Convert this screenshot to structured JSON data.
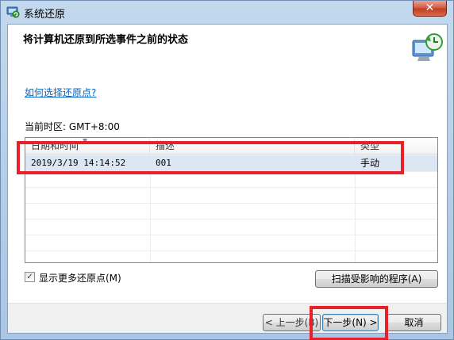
{
  "window": {
    "title": "系统还原",
    "close_label": "✕"
  },
  "header": {
    "title": "将计算机还原到所选事件之前的状态"
  },
  "help_link": "如何选择还原点?",
  "timezone_text": "当前时区: GMT+8:00",
  "list": {
    "columns": [
      "日期和时间",
      "描述",
      "类型"
    ],
    "rows": [
      {
        "datetime": "2019/3/19 14:14:52",
        "description": "001",
        "type": "手动"
      }
    ]
  },
  "show_more": {
    "label": "显示更多还原点(M)",
    "checked": true,
    "check_glyph": "✓"
  },
  "buttons": {
    "scan": "扫描受影响的程序(A)",
    "back": "< 上一步(B)",
    "next": "下一步(N) >",
    "cancel": "取消"
  },
  "colors": {
    "highlight_box": "#e8202a",
    "link": "#0066cc",
    "selected_row": "#dde7f3"
  }
}
